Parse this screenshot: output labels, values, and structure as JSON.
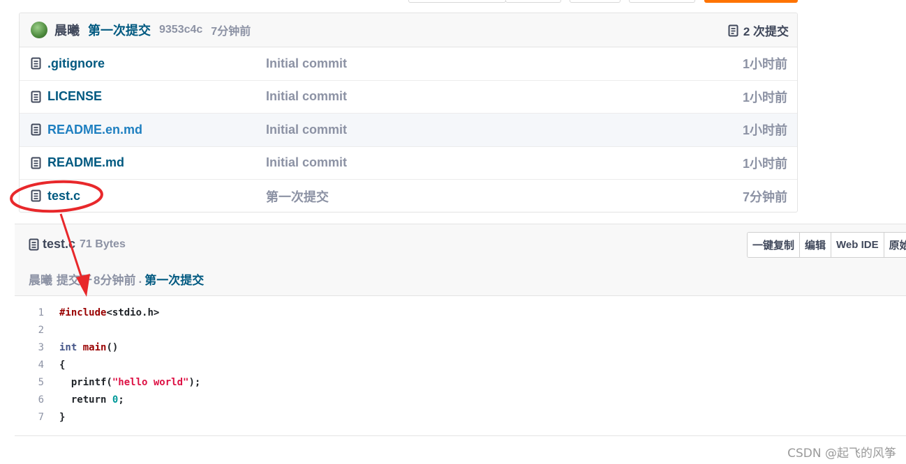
{
  "commit_bar": {
    "author": "晨曦",
    "message": "第一次提交",
    "sha": "9353c4c",
    "time": "7分钟前",
    "count": "2 次提交"
  },
  "files": [
    {
      "name": ".gitignore",
      "commit": "Initial commit",
      "time": "1小时前"
    },
    {
      "name": "LICENSE",
      "commit": "Initial commit",
      "time": "1小时前"
    },
    {
      "name": "README.en.md",
      "commit": "Initial commit",
      "time": "1小时前"
    },
    {
      "name": "README.md",
      "commit": "Initial commit",
      "time": "1小时前"
    },
    {
      "name": "test.c",
      "commit": "第一次提交",
      "time": "7分钟前"
    }
  ],
  "viewer": {
    "file_name": "test.c",
    "file_size": "71 Bytes",
    "author": "晨曦",
    "committed_prefix": "提交于",
    "committed_time": "8分钟前",
    "separator": ".",
    "commit_link": "第一次提交",
    "buttons": [
      "一键复制",
      "编辑",
      "Web IDE",
      "原始"
    ]
  },
  "code": {
    "line_numbers": [
      "1",
      "2",
      "3",
      "4",
      "5",
      "6",
      "7"
    ],
    "l1_pre": "#include",
    "l1_rest": "<stdio.h>",
    "l3_type": "int",
    "l3_fn": "main",
    "l3_rest": "()",
    "l4": "{",
    "l5_a": "  printf(",
    "l5_str": "\"hello world\"",
    "l5_b": ");",
    "l6_kw": "  return",
    "l6_num": "0",
    "l6_end": ";",
    "l7": "}"
  },
  "watermark": "CSDN @起飞的风筝",
  "colors": {
    "link": "#005980",
    "muted": "#8c92a4",
    "annotation": "#e8282b",
    "accent": "#fe7300"
  }
}
